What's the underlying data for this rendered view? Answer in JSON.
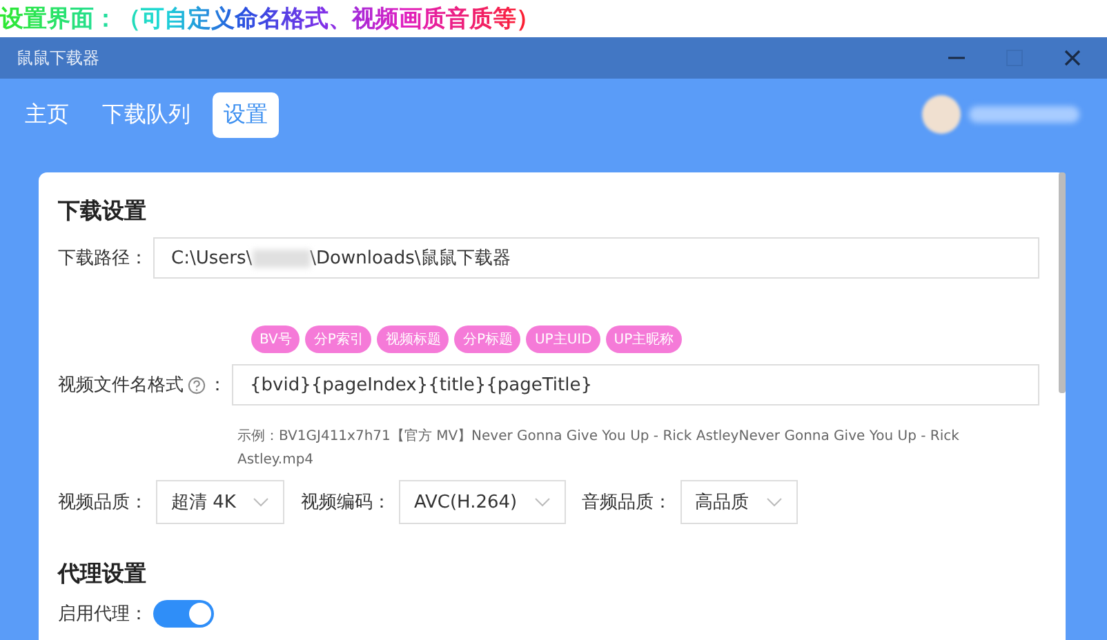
{
  "banner": {
    "title": "设置界面：（可自定义命名格式、视频画质音质等）"
  },
  "window": {
    "title": "鼠鼠下载器"
  },
  "tabs": [
    {
      "label": "主页",
      "selected": false
    },
    {
      "label": "下载队列",
      "selected": false
    },
    {
      "label": "设置",
      "selected": true
    }
  ],
  "download_settings": {
    "heading": "下载设置",
    "path": {
      "label": "下载路径：",
      "value_start": "C:\\Users\\",
      "value_end": "\\Downloads\\鼠鼠下载器"
    },
    "tokens": [
      "BV号",
      "分P索引",
      "视频标题",
      "分P标题",
      "UP主UID",
      "UP主昵称"
    ],
    "filename": {
      "label": "视频文件名格式",
      "separator": "：",
      "value": "{bvid}{pageIndex}{title}{pageTitle}",
      "example": "示例：BV1GJ411x7h71【官方 MV】Never Gonna Give You Up - Rick AstleyNever Gonna Give You Up - Rick Astley.mp4"
    },
    "selects": [
      {
        "label": "视频品质：",
        "value": "超清 4K"
      },
      {
        "label": "视频编码：",
        "value": "AVC(H.264)"
      },
      {
        "label": "音频品质：",
        "value": "高品质"
      }
    ]
  },
  "proxy_settings": {
    "heading": "代理设置",
    "enable": {
      "label": "启用代理：",
      "on": true
    }
  }
}
